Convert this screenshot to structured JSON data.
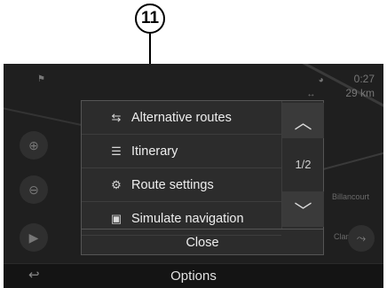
{
  "callout": {
    "number": "11"
  },
  "status": {
    "time": "0:27",
    "distance": "29 km",
    "clock_icon": "clock-icon",
    "distance_icon": "distance-arrows-icon"
  },
  "map": {
    "labels": [
      "Billancourt",
      "Clamart"
    ]
  },
  "menu": {
    "items": [
      {
        "label": "Alternative routes",
        "icon": "alternative-routes-icon",
        "glyph": "⇆"
      },
      {
        "label": "Itinerary",
        "icon": "itinerary-icon",
        "glyph": "☰"
      },
      {
        "label": "Route settings",
        "icon": "route-settings-icon",
        "glyph": "⚙"
      },
      {
        "label": "Simulate navigation",
        "icon": "simulate-navigation-icon",
        "glyph": "▣"
      }
    ],
    "page_indicator": "1/2",
    "close_label": "Close"
  },
  "bottom_bar": {
    "title": "Options"
  }
}
